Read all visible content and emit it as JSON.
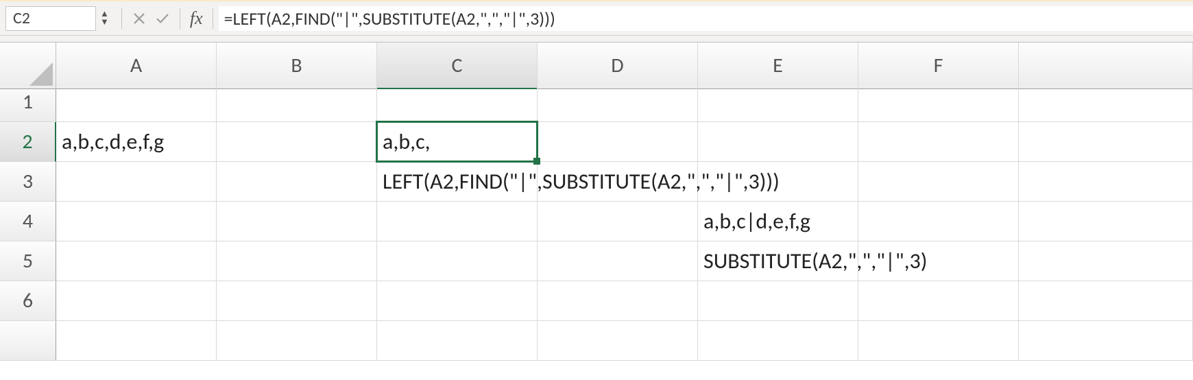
{
  "formula_bar": {
    "name_box_value": "C2",
    "fx_label": "fx",
    "formula": "=LEFT(A2,FIND(\"|\",SUBSTITUTE(A2,\",\",\"|\",3)))"
  },
  "columns": [
    "A",
    "B",
    "C",
    "D",
    "E",
    "F"
  ],
  "rows": [
    "1",
    "2",
    "3",
    "4",
    "5",
    "6"
  ],
  "active_cell": {
    "col": "C",
    "row": "2"
  },
  "cells": {
    "A2": "a,b,c,d,e,f,g",
    "C2": "a,b,c,",
    "C3": "LEFT(A2,FIND(\"|\",SUBSTITUTE(A2,\",\",\"|\",3)))",
    "E4": "a,b,c|d,e,f,g",
    "E5": "SUBSTITUTE(A2,\",\",\"|\",3)"
  },
  "icons": {
    "cancel": "cancel-icon",
    "confirm": "confirm-icon",
    "stepper_up": "stepper-up-icon",
    "stepper_down": "stepper-down-icon"
  },
  "colors": {
    "selection_border": "#217346",
    "header_bg_top": "#fdfdfd",
    "header_bg_bottom": "#ececec",
    "grid_line": "#d9d9d9"
  }
}
